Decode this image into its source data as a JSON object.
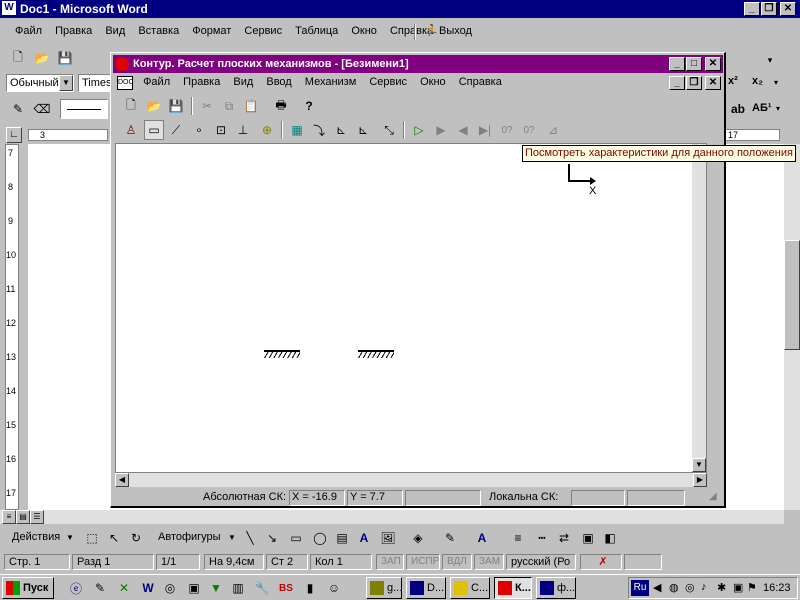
{
  "word": {
    "title": "Doc1 - Microsoft Word",
    "menu": [
      "Файл",
      "Правка",
      "Вид",
      "Вставка",
      "Формат",
      "Сервис",
      "Таблица",
      "Окно",
      "Справка"
    ],
    "exit_label": "Выход",
    "style_value": "Обычный",
    "font_value": "Times",
    "ruler_v": [
      "7",
      "8",
      "9",
      "10",
      "11",
      "12",
      "13",
      "14",
      "15",
      "16",
      "17"
    ],
    "ruler_h_left": "3",
    "ruler_h_right": "17",
    "sup_label": "x²",
    "sub_label": "x₂",
    "abc_label": "АБ¹"
  },
  "kontur": {
    "title": "Контур. Расчет плоских механизмов - [Безимени1]",
    "menu": [
      "Файл",
      "Правка",
      "Вид",
      "Ввод",
      "Механизм",
      "Сервис",
      "Окно",
      "Справка"
    ],
    "tooltip": "Посмотреть характеристики для данного положения",
    "axis_label": "X",
    "status": {
      "abs_label": "Абсолютная СК:",
      "x_value": "X = -16.9",
      "y_value": "Y = 7.7",
      "local_label": "Локальна СК:"
    }
  },
  "drawing_toolbar": {
    "actions_label": "Действия",
    "autoshapes_label": "Автофигуры"
  },
  "word_status": {
    "page": "Стр. 1",
    "section": "Разд 1",
    "pages": "1/1",
    "at": "На 9,4см",
    "line": "Ст 2",
    "col": "Кол 1",
    "rec": "ЗАП",
    "trk": "ИСПР",
    "ext": "ВДЛ",
    "ovr": "ЗАМ",
    "lang": "русский (Ро"
  },
  "taskbar": {
    "start_label": "Пуск",
    "buttons": [
      "g...",
      "D...",
      "C...",
      "К...",
      "ф..."
    ],
    "lang": "Ru",
    "clock": "16:23"
  },
  "colors": {
    "title_active": "#800080",
    "title_word": "#000080",
    "face": "#c0c0c0",
    "tooltip_bg": "#ffffe1"
  }
}
